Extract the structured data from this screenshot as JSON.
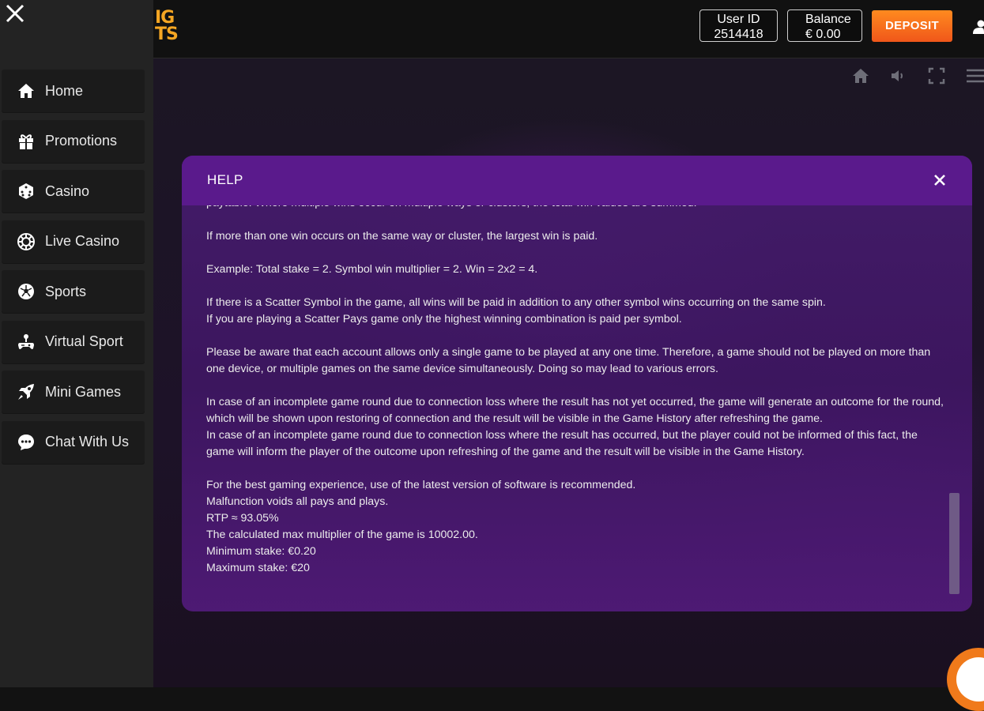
{
  "header": {
    "logo_line1": "IG",
    "logo_line2": "TS",
    "user_id_label": "User ID",
    "user_id_value": "2514418",
    "balance_label": "Balance",
    "balance_value": "€ 0.00",
    "deposit_label": "DEPOSIT"
  },
  "sidebar": {
    "items": [
      {
        "label": "Home",
        "icon": "home-icon"
      },
      {
        "label": "Promotions",
        "icon": "gift-icon"
      },
      {
        "label": "Casino",
        "icon": "dice-icon"
      },
      {
        "label": "Live Casino",
        "icon": "chip-icon"
      },
      {
        "label": "Sports",
        "icon": "soccer-ball-icon"
      },
      {
        "label": "Virtual Sport",
        "icon": "gamepad-icon"
      },
      {
        "label": "Mini Games",
        "icon": "rocket-icon"
      },
      {
        "label": "Chat With Us",
        "icon": "chat-icon"
      }
    ]
  },
  "modal": {
    "title": "HELP",
    "paragraphs": [
      "paytable. Where multiple wins occur on multiple ways or clusters, the total win values are summed.",
      "If more than one win occurs on the same way or cluster, the largest win is paid.",
      "Example: Total stake = 2. Symbol win multiplier = 2. Win = 2x2 = 4.",
      "If there is a Scatter Symbol in the game, all wins will be paid in addition to any other symbol wins occurring on the same spin.\nIf you are playing a Scatter Pays game only the highest winning combination is paid per symbol.",
      "Please be aware that each account allows only a single game to be played at any one time. Therefore, a game should not be played on more than one device, or multiple games on the same device simultaneously. Doing so may lead to various errors.",
      "In case of an incomplete game round due to connection loss where the result has not yet occurred, the game will generate an outcome for the round, which will be shown upon restoring of connection and the result will be visible in the Game History after refreshing the game.\nIn case of an incomplete game round due to connection loss where the result has occurred, but the player could not be informed of this fact, the game will inform the player of the outcome upon refreshing of the game and the result will be visible in the Game History.",
      "For the best gaming experience, use of the latest version of software is recommended.\nMalfunction voids all pays and plays.\nRTP ≈ 93.05%\nThe calculated max multiplier of the game is 10002.00.\nMinimum stake: €0.20\nMaximum stake: €20"
    ]
  },
  "colors": {
    "accent_orange": "#f0571a",
    "modal_header": "#5a1a8c",
    "logo_gold": "#f5a623"
  }
}
